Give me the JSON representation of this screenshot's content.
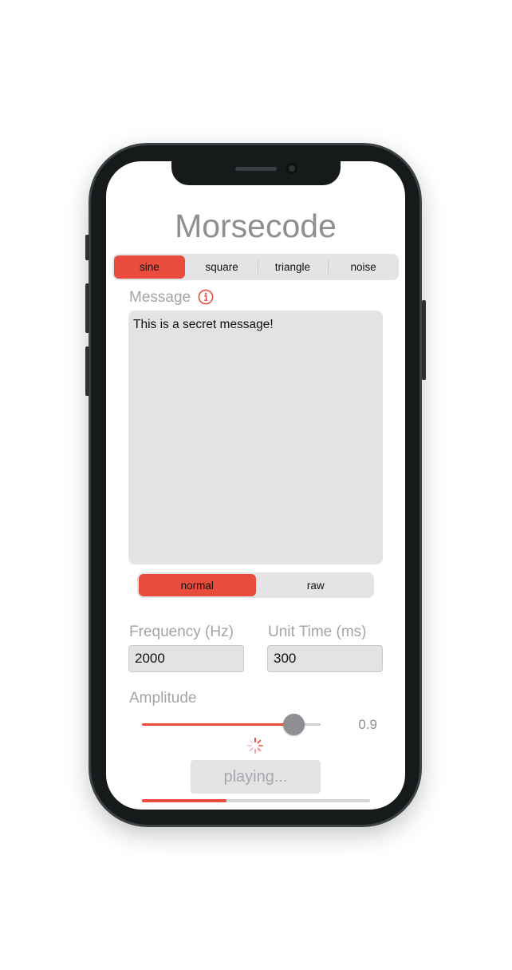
{
  "app": {
    "title": "Morsecode"
  },
  "waveform": {
    "options": [
      "sine",
      "square",
      "triangle",
      "noise"
    ],
    "selected": "sine"
  },
  "message": {
    "label": "Message",
    "info_icon": "info-icon",
    "value": "This is a secret message!"
  },
  "mode": {
    "options": [
      "normal",
      "raw"
    ],
    "selected": "normal"
  },
  "frequency": {
    "label": "Frequency (Hz)",
    "value": "2000"
  },
  "unit_time": {
    "label": "Unit Time (ms)",
    "value": "300"
  },
  "amplitude": {
    "label": "Amplitude",
    "value": "0.9",
    "slider_fraction": 0.9
  },
  "play": {
    "label": "playing...",
    "progress_fraction": 0.37
  },
  "colors": {
    "accent": "#e94b3c",
    "muted_text": "#8e8e93",
    "field_bg": "#e3e3e5"
  }
}
